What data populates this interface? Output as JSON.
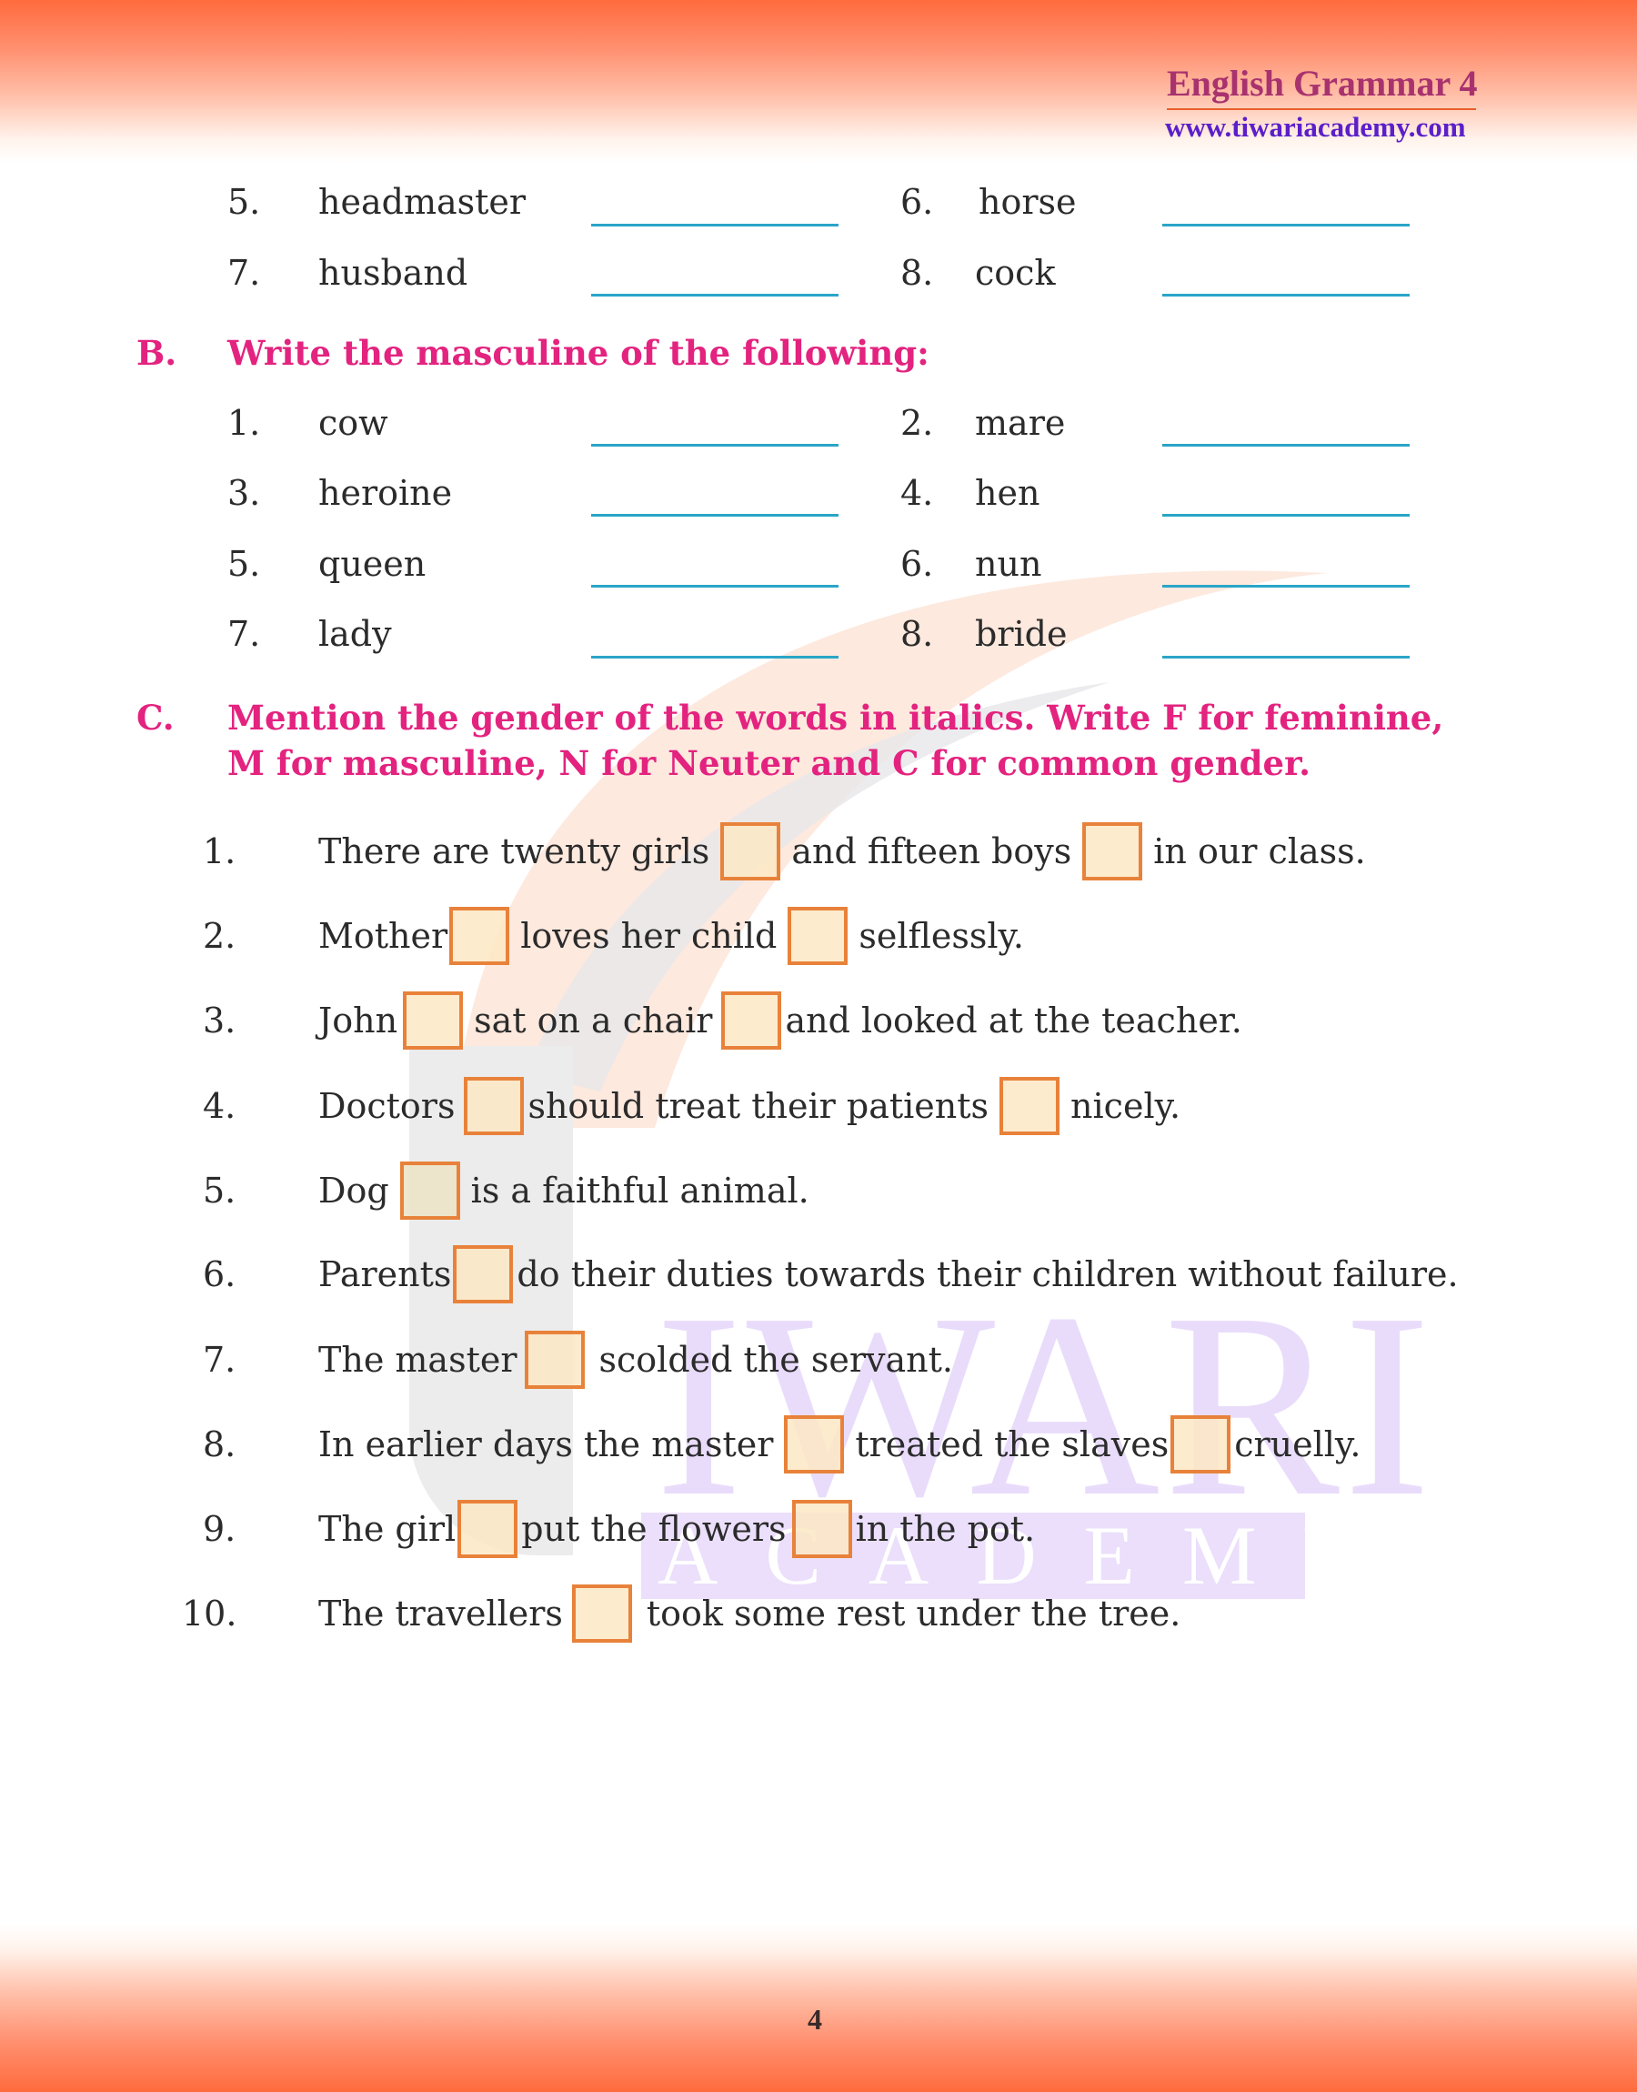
{
  "header": {
    "title": "English Grammar 4",
    "url": "www.tiwariacademy.com"
  },
  "watermark": {
    "line1": "IWARI",
    "line2": "ACADEMY"
  },
  "section_a_continued": {
    "items": [
      {
        "num": "5.",
        "word": "headmaster"
      },
      {
        "num": "6.",
        "word": "horse"
      },
      {
        "num": "7.",
        "word": "husband"
      },
      {
        "num": "8.",
        "word": "cock"
      }
    ]
  },
  "section_b": {
    "letter": "B.",
    "instruction": "Write the masculine of the following:",
    "items": [
      {
        "num": "1.",
        "word": "cow"
      },
      {
        "num": "2.",
        "word": "mare"
      },
      {
        "num": "3.",
        "word": "heroine"
      },
      {
        "num": "4.",
        "word": "hen"
      },
      {
        "num": "5.",
        "word": "queen"
      },
      {
        "num": "6.",
        "word": "nun"
      },
      {
        "num": "7.",
        "word": "lady"
      },
      {
        "num": "8.",
        "word": "bride"
      }
    ]
  },
  "section_c": {
    "letter": "C.",
    "instruction_line1": "Mention the gender of the words in italics. Write F for feminine,",
    "instruction_line2": "M for masculine, N for Neuter and C for common gender.",
    "sentences": [
      {
        "num": "1.",
        "parts": [
          "There are twenty girls",
          "and fifteen boys",
          "in our class."
        ]
      },
      {
        "num": "2.",
        "parts": [
          "Mother",
          "loves her child",
          "selflessly."
        ]
      },
      {
        "num": "3.",
        "parts": [
          "John",
          "sat on a chair",
          "and looked at the teacher."
        ]
      },
      {
        "num": "4.",
        "parts": [
          "Doctors",
          "should treat their patients",
          "nicely."
        ]
      },
      {
        "num": "5.",
        "parts": [
          "Dog",
          "is a faithful animal."
        ]
      },
      {
        "num": "6.",
        "parts": [
          "Parents",
          "do their duties towards their children without failure."
        ]
      },
      {
        "num": "7.",
        "parts": [
          "The master",
          "scolded the servant."
        ]
      },
      {
        "num": "8.",
        "parts": [
          "In earlier days the master",
          "treated the slaves",
          "cruelly."
        ]
      },
      {
        "num": "9.",
        "parts": [
          "The girl",
          "put the flowers",
          "in the pot."
        ]
      },
      {
        "num": "10.",
        "parts": [
          "The travellers",
          "took some rest under the tree."
        ]
      }
    ]
  },
  "colors": {
    "band": "#ff6b3d",
    "heading": "#e3237f",
    "blank_line": "#2aa5c8",
    "box_border": "#e8823a",
    "box_fill": "#fde8c4"
  },
  "footer": {
    "page_number": "4"
  }
}
